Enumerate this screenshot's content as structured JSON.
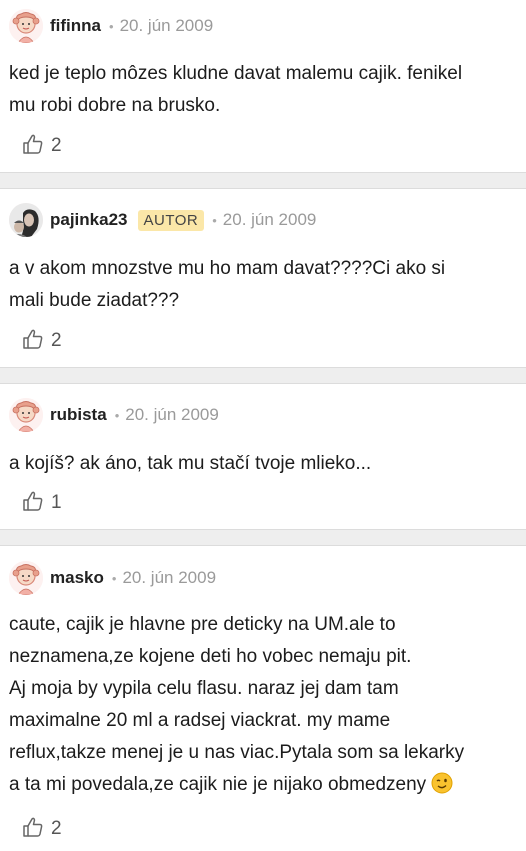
{
  "comments": [
    {
      "username": "fifinna",
      "badge": "",
      "separator": "•",
      "date": "20. jún 2009",
      "text": "ked je teplo môzes kludne davat malemu cajik. fenikel\nmu robi dobre na brusko.",
      "likes": "2",
      "avatar": "doll-avatar-icon"
    },
    {
      "username": "pajinka23",
      "badge": "AUTOR",
      "separator": "•",
      "date": "20. jún 2009",
      "text": "a v akom mnozstve mu ho mam davat????Ci ako si\nmali bude ziadat???",
      "likes": "2",
      "avatar": "photo-avatar"
    },
    {
      "username": "rubista",
      "badge": "",
      "separator": "•",
      "date": "20. jún 2009",
      "text": "a kojíš? ak áno, tak mu stačí tvoje mlieko...",
      "likes": "1",
      "avatar": "doll-avatar-icon"
    },
    {
      "username": "masko",
      "badge": "",
      "separator": "•",
      "date": "20. jún 2009",
      "text": "caute, cajik je hlavne pre deticky na UM.ale to\nneznamena,ze kojene deti ho vobec nemaju pit.\nAj moja by vypila celu flasu. naraz jej dam tam\nmaximalne 20 ml a radsej viackrat. my mame\nreflux,takze menej je u nas viac.Pytala som sa lekarky\na ta mi povedala,ze cajik nie je nijako obmedzeny",
      "likes": "2",
      "avatar": "doll-avatar-icon",
      "emoji": "winking-face-emoji"
    }
  ],
  "colors": {
    "badge_bg": "#fbe7a8",
    "separator_bg": "#eeeeee",
    "date": "#9a9a9a"
  }
}
